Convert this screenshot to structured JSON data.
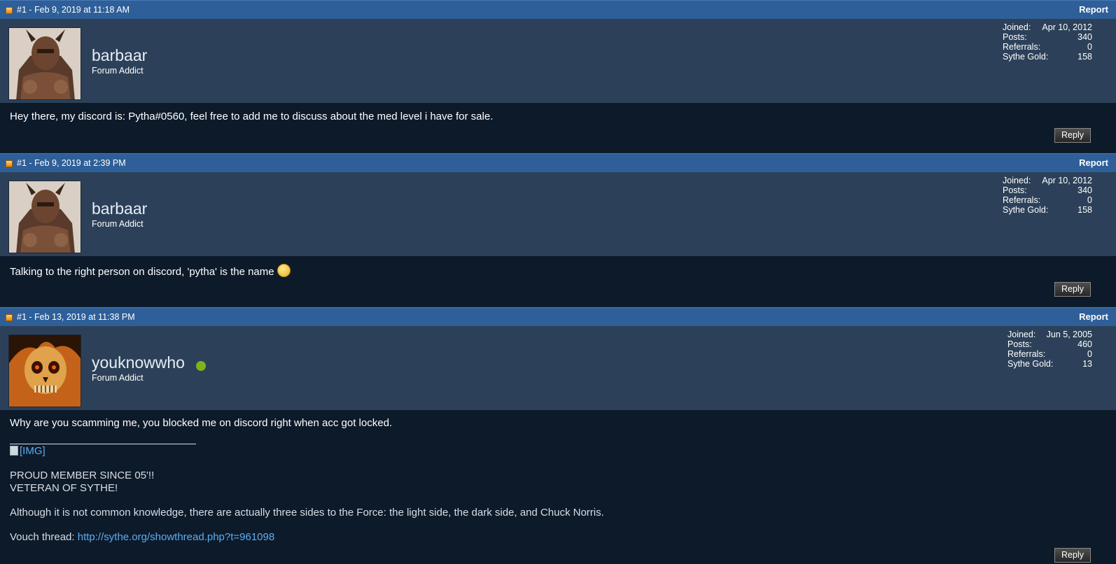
{
  "posts": [
    {
      "date": "#1 - Feb 9, 2019 at 11:18 AM",
      "report": "Report",
      "username": "barbaar",
      "rank": "Forum Addict",
      "online": false,
      "stats": {
        "joined_label": "Joined:",
        "joined": "Apr 10, 2012",
        "posts_label": "Posts:",
        "posts": "340",
        "referrals_label": "Referrals:",
        "referrals": "0",
        "gold_label": "Sythe Gold:",
        "gold": "158"
      },
      "message": "Hey there, my discord is: Pytha#0560, feel free to add me to discuss about the med level i have for sale.",
      "reply": "Reply",
      "avatar": "helmeted-warrior-avatar"
    },
    {
      "date": "#1 - Feb 9, 2019 at 2:39 PM",
      "report": "Report",
      "username": "barbaar",
      "rank": "Forum Addict",
      "online": false,
      "stats": {
        "joined_label": "Joined:",
        "joined": "Apr 10, 2012",
        "posts_label": "Posts:",
        "posts": "340",
        "referrals_label": "Referrals:",
        "referrals": "0",
        "gold_label": "Sythe Gold:",
        "gold": "158"
      },
      "message": "Talking to the right person on discord, 'pytha' is the name",
      "smiley": "smiley-icon",
      "reply": "Reply",
      "avatar": "helmeted-warrior-avatar"
    },
    {
      "date": "#1 - Feb 13, 2019 at 11:38 PM",
      "report": "Report",
      "username": "youknowwho",
      "rank": "Forum Addict",
      "online": true,
      "stats": {
        "joined_label": "Joined:",
        "joined": "Jun 5, 2005",
        "posts_label": "Posts:",
        "posts": "460",
        "referrals_label": "Referrals:",
        "referrals": "0",
        "gold_label": "Sythe Gold:",
        "gold": "13"
      },
      "message": "Why are you scamming me, you blocked me on discord right when acc got locked.",
      "signature": {
        "img_alt": "[IMG]",
        "line1": "PROUD MEMBER SINCE 05'!!",
        "line2": "VETERAN OF SYTHE!",
        "quote": "Although it is not common knowledge, there are actually three sides to the Force: the light side, the dark side, and Chuck Norris.",
        "vouch_label": "Vouch thread: ",
        "vouch_link": "http://sythe.org/showthread.php?t=961098"
      },
      "reply": "Reply",
      "avatar": "flaming-skull-avatar"
    }
  ],
  "colors": {
    "header_bar": "#2e5f98",
    "user_bar": "#2c4159",
    "post_body": "#0d1a2a",
    "link": "#5aaef0",
    "online": "#7eb31c"
  }
}
